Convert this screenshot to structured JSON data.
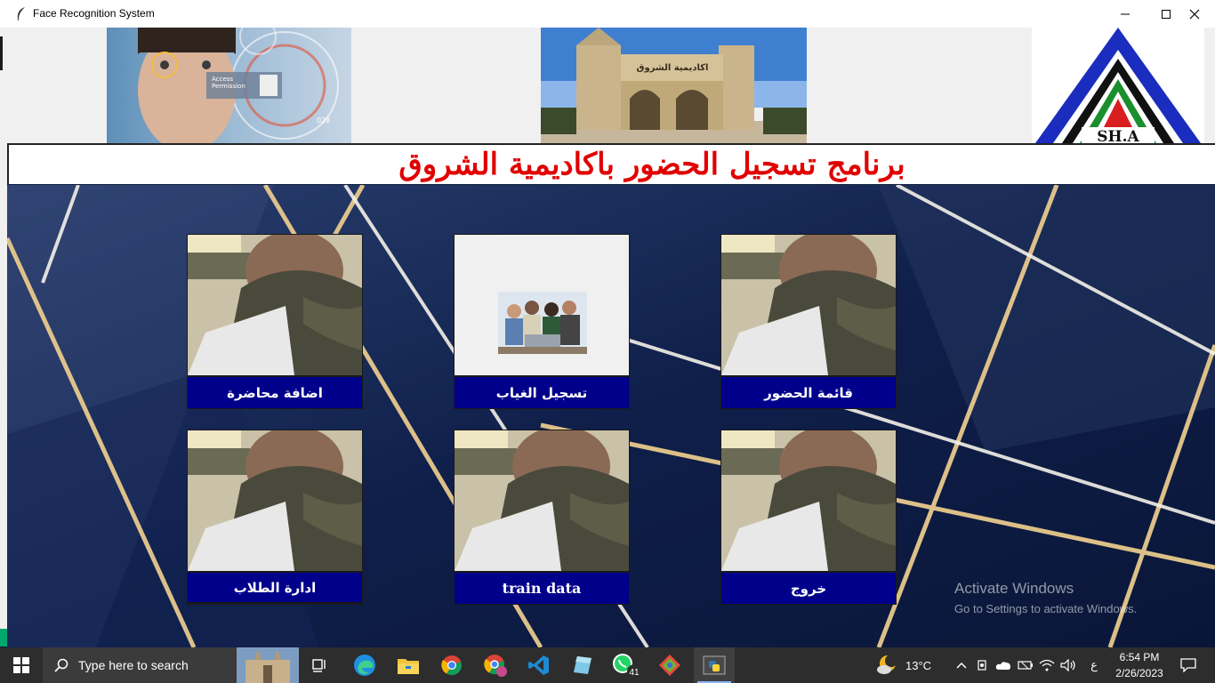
{
  "window": {
    "title": "Face Recognition System"
  },
  "header": {
    "face_card": {
      "line1": "Access",
      "line2": "Permission",
      "code": "028"
    },
    "gate_sign": "اكاديمية الشروق",
    "logo_text": "SH.A"
  },
  "banner": {
    "title": "برنامج تسجيل الحضور باكاديمية الشروق"
  },
  "tiles": [
    {
      "label": "اضافة محاضرة"
    },
    {
      "label": "تسجيل الغياب"
    },
    {
      "label": "قائمة الحضور"
    },
    {
      "label": "ادارة الطلاب"
    },
    {
      "label": "train data"
    },
    {
      "label": "خروج"
    }
  ],
  "watermark": {
    "line1": "Activate Windows",
    "line2": "Go to Settings to activate Windows."
  },
  "taskbar": {
    "search_placeholder": "Type here to search",
    "whatsapp_badge": "41",
    "weather": "13°C",
    "lang": "ع",
    "time": "6:54 PM",
    "date": "2/26/2023"
  },
  "colors": {
    "banner_text": "#e00000",
    "tile_label_bg": "#00008b",
    "background": "#0d1b3d",
    "taskbar": "#2d2d2d"
  }
}
